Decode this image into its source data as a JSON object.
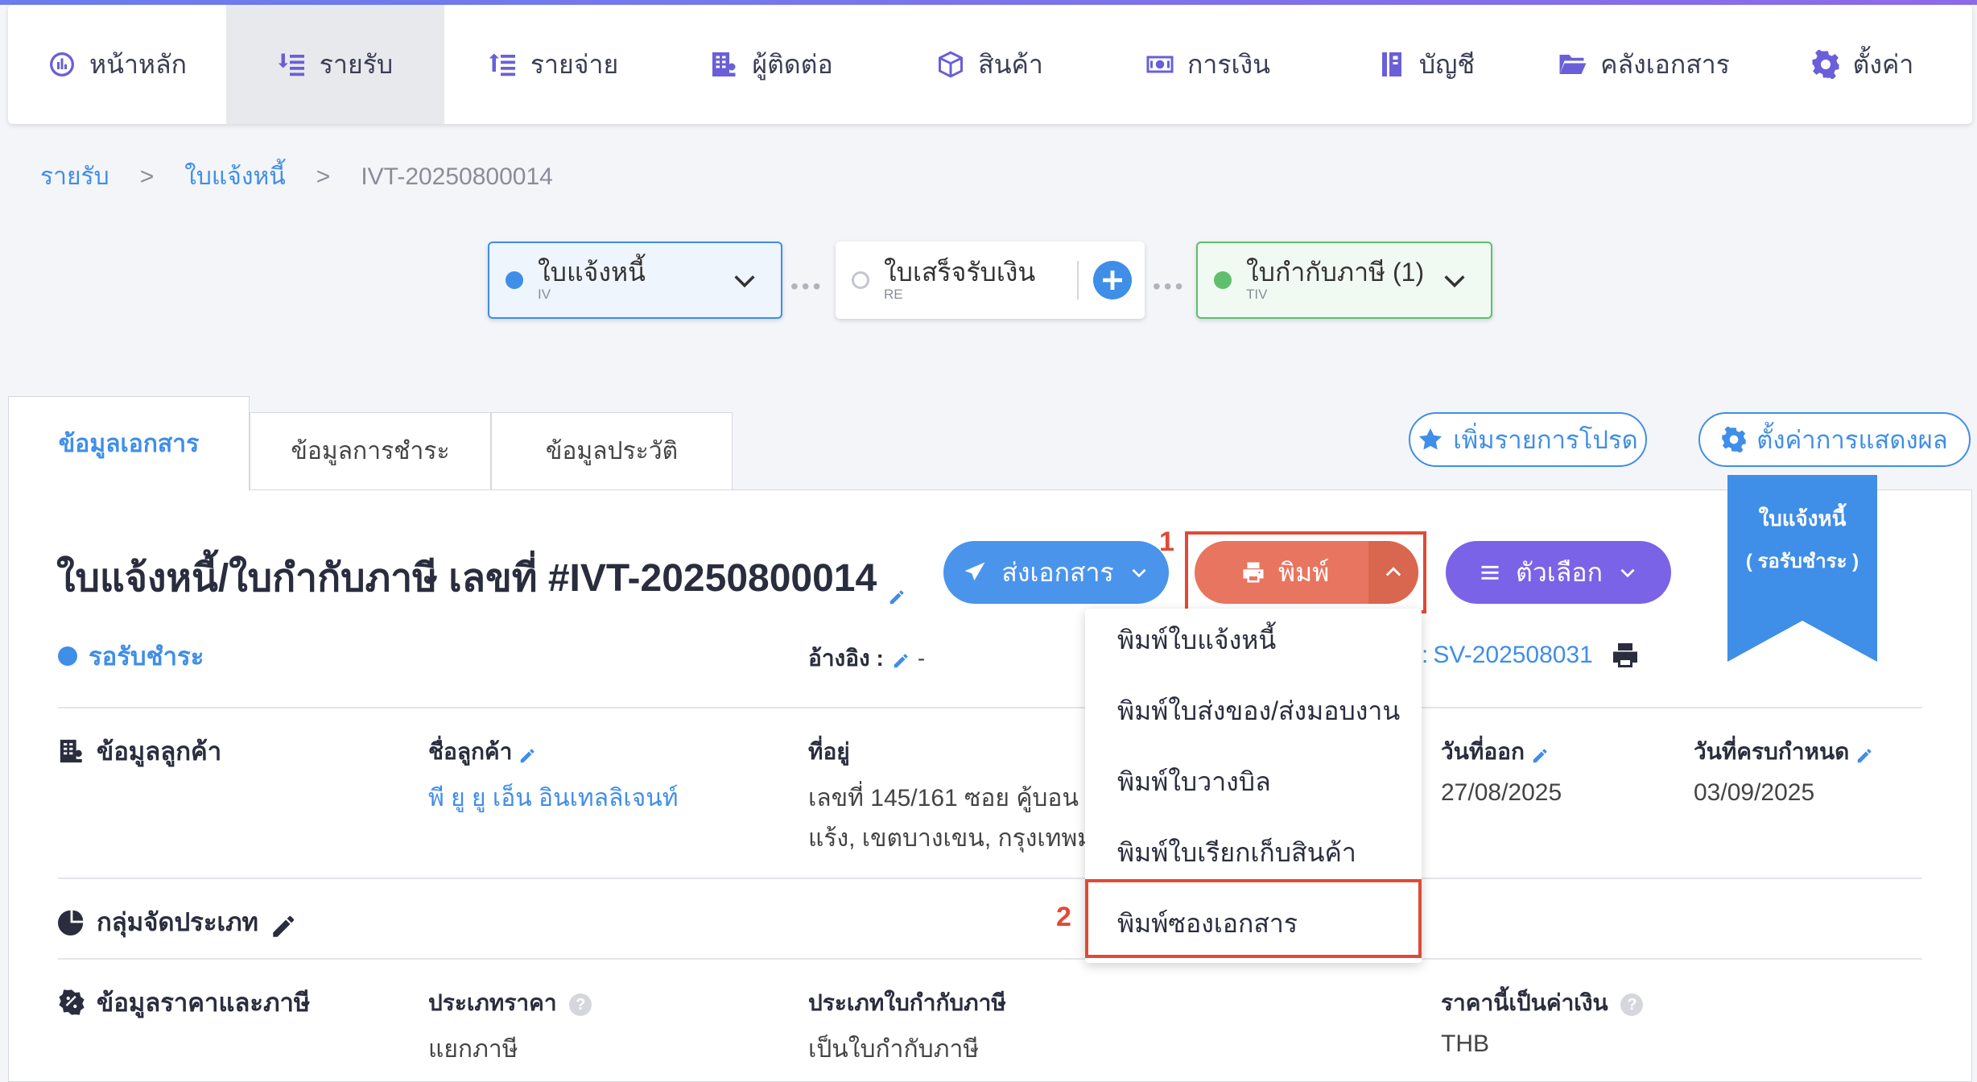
{
  "nav": [
    {
      "label": "หน้าหลัก",
      "icon": "dashboard-icon"
    },
    {
      "label": "รายรับ",
      "icon": "income-icon",
      "active": true
    },
    {
      "label": "รายจ่าย",
      "icon": "expense-icon"
    },
    {
      "label": "ผู้ติดต่อ",
      "icon": "contacts-icon"
    },
    {
      "label": "สินค้า",
      "icon": "box-icon"
    },
    {
      "label": "การเงิน",
      "icon": "money-icon"
    },
    {
      "label": "บัญชี",
      "icon": "ledger-icon"
    },
    {
      "label": "คลังเอกสาร",
      "icon": "folder-icon"
    },
    {
      "label": "ตั้งค่า",
      "icon": "gear-icon"
    }
  ],
  "breadcrumb": {
    "level1": "รายรับ",
    "level2": "ใบแจ้งหนี้",
    "current": "IVT-20250800014",
    "sep": ">"
  },
  "flow": {
    "iv": {
      "title": "ใบแจ้งหนี้",
      "code": "IV"
    },
    "re": {
      "title": "ใบเสร็จรับเงิน",
      "code": "RE"
    },
    "tiv": {
      "title": "ใบกำกับภาษี (1)",
      "code": "TIV"
    },
    "dots": "•••"
  },
  "tabs": {
    "doc_info": "ข้อมูลเอกสาร",
    "payment_info": "ข้อมูลการชำระ",
    "history_info": "ข้อมูลประวัติ"
  },
  "actions": {
    "favorite": "เพิ่มรายการโปรด",
    "display_settings": "ตั้งค่าการแสดงผล"
  },
  "document": {
    "title": "ใบแจ้งหนี้/ใบกำกับภาษี เลขที่ #IVT-20250800014",
    "status": "รอรับชำระ",
    "reference_label": "อ้างอิง :",
    "reference_value": "-",
    "sv_prefix": ":",
    "sv_value": "SV-202508031"
  },
  "buttons": {
    "send": "ส่งเอกสาร",
    "print": "พิมพ์",
    "options": "ตัวเลือก"
  },
  "annotations": {
    "one": "1",
    "two": "2"
  },
  "print_menu": [
    "พิมพ์ใบแจ้งหนี้",
    "พิมพ์ใบส่งของ/ส่งมอบงาน",
    "พิมพ์ใบวางบิล",
    "พิมพ์ใบเรียกเก็บสินค้า",
    "พิมพ์ซองเอกสาร"
  ],
  "ribbon": {
    "line1": "ใบแจ้งหนี้",
    "line2": "( รอรับชำระ )"
  },
  "customer": {
    "section": "ข้อมูลลูกค้า",
    "name_label": "ชื่อลูกค้า",
    "name_value": "พี ยู ยู เอ็น อินเทลลิเจนท์",
    "address_label": "ที่อยู่",
    "address_line1": "เลขที่ 145/161 ซอย คู้บอน",
    "address_line2": "แร้ง, เขตบางเขน, กรุงเทพมห",
    "issue_label": "วันที่ออก",
    "issue_value": "27/08/2025",
    "due_label": "วันที่ครบกำหนด",
    "due_value": "03/09/2025"
  },
  "category": {
    "section": "กลุ่มจัดประเภท"
  },
  "pricing": {
    "section": "ข้อมูลราคาและภาษี",
    "price_type_label": "ประเภทราคา",
    "price_type_value": "แยกภาษี",
    "tax_doc_label": "ประเภทใบกำกับภาษี",
    "tax_doc_value": "เป็นใบกำกับภาษี",
    "currency_label": "ราคานี้เป็นค่าเงิน",
    "currency_value": "THB",
    "help": "?"
  },
  "colors": {
    "primary": "#3f8ee8",
    "print": "#e8755f",
    "options": "#7a63e6",
    "annotation": "#e04a36",
    "green": "#5fbf6e"
  }
}
